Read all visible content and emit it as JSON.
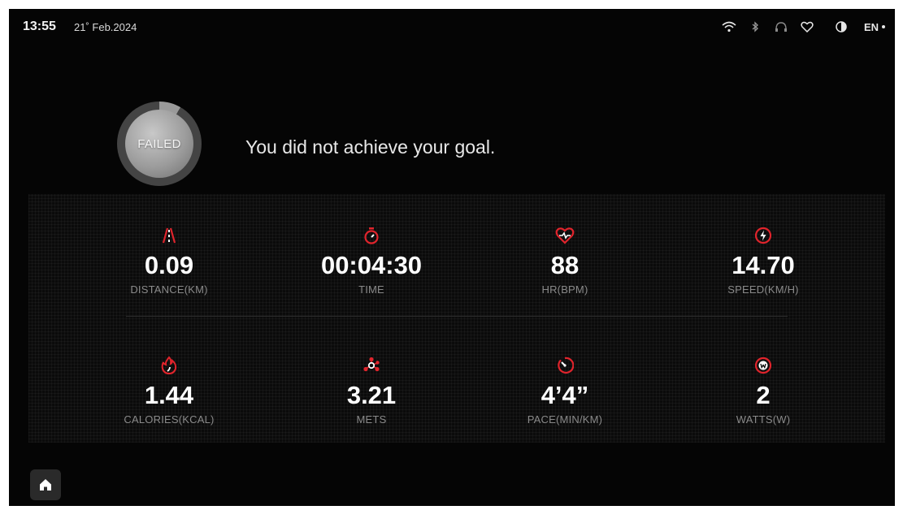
{
  "status_bar": {
    "time": "13:55",
    "date": "21˚ Feb.2024",
    "language": "EN",
    "icons": [
      "wifi-icon",
      "bluetooth-icon",
      "headphones-icon",
      "heart-outline-icon",
      "contrast-icon"
    ]
  },
  "result": {
    "badge": "FAILED",
    "message": "You did not achieve your goal."
  },
  "stats": [
    {
      "value": "0.09",
      "label": "DISTANCE(KM)",
      "icon": "distance-road-icon"
    },
    {
      "value": "00:04:30",
      "label": "TIME",
      "icon": "stopwatch-icon"
    },
    {
      "value": "88",
      "label": "HR(BPM)",
      "icon": "heart-rate-icon"
    },
    {
      "value": "14.70",
      "label": "SPEED(KM/H)",
      "icon": "speed-bolt-icon"
    },
    {
      "value": "1.44",
      "label": "CALORIES(KCAL)",
      "icon": "flame-icon"
    },
    {
      "value": "3.21",
      "label": "METS",
      "icon": "mets-molecule-icon"
    },
    {
      "value": "4’4”",
      "label": "PACE(MIN/KM)",
      "icon": "pace-gauge-icon"
    },
    {
      "value": "2",
      "label": "WATTS(W)",
      "icon": "watts-icon"
    }
  ],
  "colors": {
    "accent": "#e0242c",
    "background": "#050505",
    "label": "#8a8a8a"
  },
  "home": {
    "icon": "home-icon"
  }
}
